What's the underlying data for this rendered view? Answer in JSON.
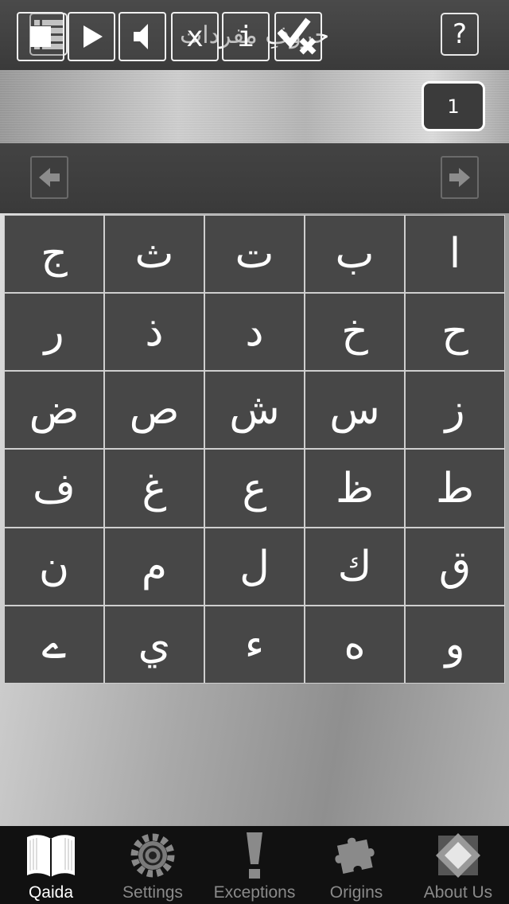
{
  "header": {
    "title": "حروفِ مفردات",
    "menu_icon": "list-icon",
    "help_label": "?"
  },
  "toolbar": {
    "buttons": [
      {
        "name": "stop",
        "icon": "stop-icon"
      },
      {
        "name": "play",
        "icon": "play-icon"
      },
      {
        "name": "sound",
        "icon": "speaker-icon"
      },
      {
        "name": "close",
        "label": "x"
      },
      {
        "name": "info",
        "label": "i"
      },
      {
        "name": "check",
        "icon": "check-cross-icon"
      }
    ],
    "page_number": "1"
  },
  "nav": {
    "prev_icon": "arrow-left-icon",
    "next_icon": "arrow-right-icon"
  },
  "letters": [
    "ا",
    "ب",
    "ت",
    "ث",
    "ج",
    "ح",
    "خ",
    "د",
    "ذ",
    "ر",
    "ز",
    "س",
    "ش",
    "ص",
    "ض",
    "ط",
    "ظ",
    "ع",
    "غ",
    "ف",
    "ق",
    "ك",
    "ل",
    "م",
    "ن",
    "و",
    "ه",
    "ء",
    "ي",
    "ے"
  ],
  "tabs": [
    {
      "label": "Qaida",
      "icon": "book-icon",
      "active": true
    },
    {
      "label": "Settings",
      "icon": "gear-icon",
      "active": false
    },
    {
      "label": "Exceptions",
      "icon": "exclamation-icon",
      "active": false
    },
    {
      "label": "Origins",
      "icon": "puzzle-icon",
      "active": false
    },
    {
      "label": "About Us",
      "icon": "diamond-icon",
      "active": false
    }
  ],
  "colors": {
    "header_bg": "#3e3e3e",
    "cell_bg": "#474747",
    "grid_line": "#cfcfcf",
    "tabbar_bg": "#111111",
    "tab_inactive": "#8a8a8a",
    "tab_active": "#ffffff"
  }
}
